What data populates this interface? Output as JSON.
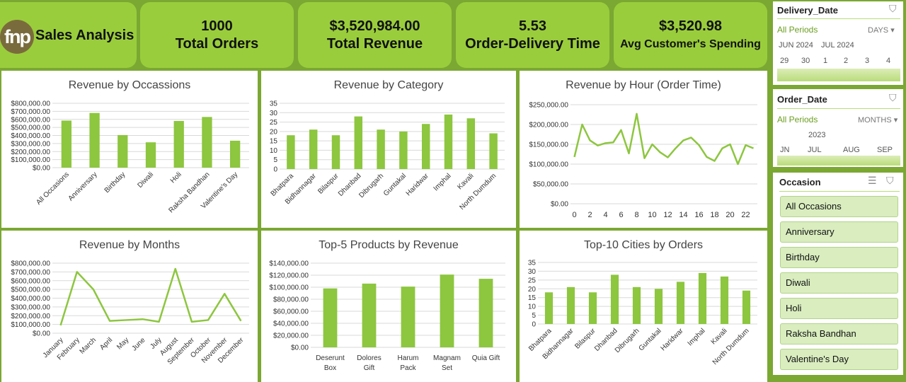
{
  "brand": {
    "logo_text": "fnp",
    "title": "Sales Analysis"
  },
  "kpis": [
    {
      "value": "1000",
      "label": "Total Orders"
    },
    {
      "value": "$3,520,984.00",
      "label": "Total Revenue"
    },
    {
      "value": "5.53",
      "label": "Order-Delivery Time"
    },
    {
      "value": "$3,520.98",
      "label": "Avg Customer's Spending"
    }
  ],
  "colors": {
    "accent": "#9acd3c",
    "frame": "#7aa832",
    "series": "#8dc63f"
  },
  "charts": {
    "occasions": {
      "title": "Revenue by Occassions"
    },
    "category": {
      "title": "Revenue by Category"
    },
    "hour": {
      "title": "Revenue by Hour (Order Time)"
    },
    "months": {
      "title": "Revenue by Months"
    },
    "products": {
      "title": "Top-5 Products by Revenue"
    },
    "cities": {
      "title": "Top-10 Cities by Orders"
    }
  },
  "chart_data": [
    {
      "id": "occasions",
      "type": "bar",
      "title": "Revenue by Occassions",
      "categories": [
        "All Occasions",
        "Anniversary",
        "Birthday",
        "Diwali",
        "Holi",
        "Raksha Bandhan",
        "Valentine's Day"
      ],
      "values": [
        585000,
        680000,
        405000,
        315000,
        580000,
        630000,
        335000
      ],
      "ylim": [
        0,
        800000
      ],
      "yticks": [
        0,
        100000,
        200000,
        300000,
        400000,
        500000,
        600000,
        700000,
        800000
      ],
      "ytick_labels": [
        "$0.00",
        "$100,000.00",
        "$200,000.00",
        "$300,000.00",
        "$400,000.00",
        "$500,000.00",
        "$600,000.00",
        "$700,000.00",
        "$800,000.00"
      ],
      "grid": true
    },
    {
      "id": "category",
      "type": "bar",
      "title": "Revenue by Category",
      "categories": [
        "Bhatpara",
        "Bidhannagar",
        "Bilaspur",
        "Dhanbad",
        "Dibrugarh",
        "Guntakal",
        "Haridwar",
        "Imphal",
        "Kavali",
        "North Dumdum"
      ],
      "values": [
        18,
        21,
        18,
        28,
        21,
        20,
        24,
        29,
        27,
        19
      ],
      "ylim": [
        0,
        35
      ],
      "yticks": [
        0,
        5,
        10,
        15,
        20,
        25,
        30,
        35
      ],
      "ytick_labels": [
        "0",
        "5",
        "10",
        "15",
        "20",
        "25",
        "30",
        "35"
      ],
      "grid": true
    },
    {
      "id": "hour",
      "type": "line",
      "title": "Revenue by Hour (Order Time)",
      "x": [
        0,
        1,
        2,
        3,
        4,
        5,
        6,
        7,
        8,
        9,
        10,
        11,
        12,
        13,
        14,
        15,
        16,
        17,
        18,
        19,
        20,
        21,
        22,
        23
      ],
      "values": [
        118000,
        200000,
        160000,
        147000,
        153000,
        155000,
        186000,
        127000,
        227000,
        115000,
        150000,
        130000,
        117000,
        140000,
        160000,
        167000,
        148000,
        118000,
        108000,
        140000,
        150000,
        100000,
        148000,
        140000
      ],
      "xtick_labels": [
        "0",
        "2",
        "4",
        "6",
        "8",
        "10",
        "12",
        "14",
        "16",
        "18",
        "20",
        "22"
      ],
      "ylim": [
        0,
        250000
      ],
      "yticks": [
        0,
        50000,
        100000,
        150000,
        200000,
        250000
      ],
      "ytick_labels": [
        "$0.00",
        "$50,000.00",
        "$100,000.00",
        "$150,000.00",
        "$200,000.00",
        "$250,000.00"
      ],
      "grid": true
    },
    {
      "id": "months",
      "type": "line",
      "title": "Revenue by Months",
      "categories": [
        "January",
        "February",
        "March",
        "April",
        "May",
        "June",
        "July",
        "August",
        "September",
        "October",
        "November",
        "December"
      ],
      "values": [
        90000,
        700000,
        500000,
        140000,
        150000,
        160000,
        130000,
        735000,
        130000,
        150000,
        450000,
        140000
      ],
      "ylim": [
        0,
        800000
      ],
      "yticks": [
        0,
        100000,
        200000,
        300000,
        400000,
        500000,
        600000,
        700000,
        800000
      ],
      "ytick_labels": [
        "$0.00",
        "$100,000.00",
        "$200,000.00",
        "$300,000.00",
        "$400,000.00",
        "$500,000.00",
        "$600,000.00",
        "$700,000.00",
        "$800,000.00"
      ],
      "grid": true
    },
    {
      "id": "products",
      "type": "bar",
      "title": "Top-5 Products by Revenue",
      "categories": [
        "Deserunt Box",
        "Dolores Gift",
        "Harum Pack",
        "Magnam Set",
        "Quia Gift"
      ],
      "category_lines": [
        [
          "Deserunt",
          "Box"
        ],
        [
          "Dolores",
          "Gift"
        ],
        [
          "Harum",
          "Pack"
        ],
        [
          "Magnam",
          "Set"
        ],
        [
          "Quia Gift"
        ]
      ],
      "values": [
        98000,
        106000,
        101000,
        121000,
        114000
      ],
      "ylim": [
        0,
        140000
      ],
      "yticks": [
        0,
        20000,
        40000,
        60000,
        80000,
        100000,
        120000,
        140000
      ],
      "ytick_labels": [
        "$0.00",
        "$20,000.00",
        "$40,000.00",
        "$60,000.00",
        "$80,000.00",
        "$100,000.00",
        "$120,000.00",
        "$140,000.00"
      ],
      "grid": true
    },
    {
      "id": "cities",
      "type": "bar",
      "title": "Top-10 Cities by Orders",
      "categories": [
        "Bhatpara",
        "Bidhannagar",
        "Bilaspur",
        "Dhanbad",
        "Dibrugarh",
        "Guntakal",
        "Haridwar",
        "Imphal",
        "Kavali",
        "North Dumdum"
      ],
      "values": [
        18,
        21,
        18,
        28,
        21,
        20,
        24,
        29,
        27,
        19
      ],
      "ylim": [
        0,
        35
      ],
      "yticks": [
        0,
        5,
        10,
        15,
        20,
        25,
        30,
        35
      ],
      "ytick_labels": [
        "0",
        "5",
        "10",
        "15",
        "20",
        "25",
        "30",
        "35"
      ],
      "grid": true
    }
  ],
  "slicers": {
    "delivery": {
      "title": "Delivery_Date",
      "periods": "All Periods",
      "level": "DAYS",
      "level_icon": "dropdown-icon",
      "months": [
        "JUN 2024",
        "JUL 2024"
      ],
      "days": [
        "29",
        "30",
        "1",
        "2",
        "3",
        "4"
      ]
    },
    "order": {
      "title": "Order_Date",
      "periods": "All Periods",
      "level": "MONTHS",
      "level_icon": "dropdown-icon",
      "year": "2023",
      "months": [
        "JN",
        "JUL",
        "AUG",
        "SEP"
      ]
    },
    "occasion": {
      "title": "Occasion",
      "items": [
        "All Occasions",
        "Anniversary",
        "Birthday",
        "Diwali",
        "Holi",
        "Raksha Bandhan",
        "Valentine's Day"
      ]
    }
  }
}
